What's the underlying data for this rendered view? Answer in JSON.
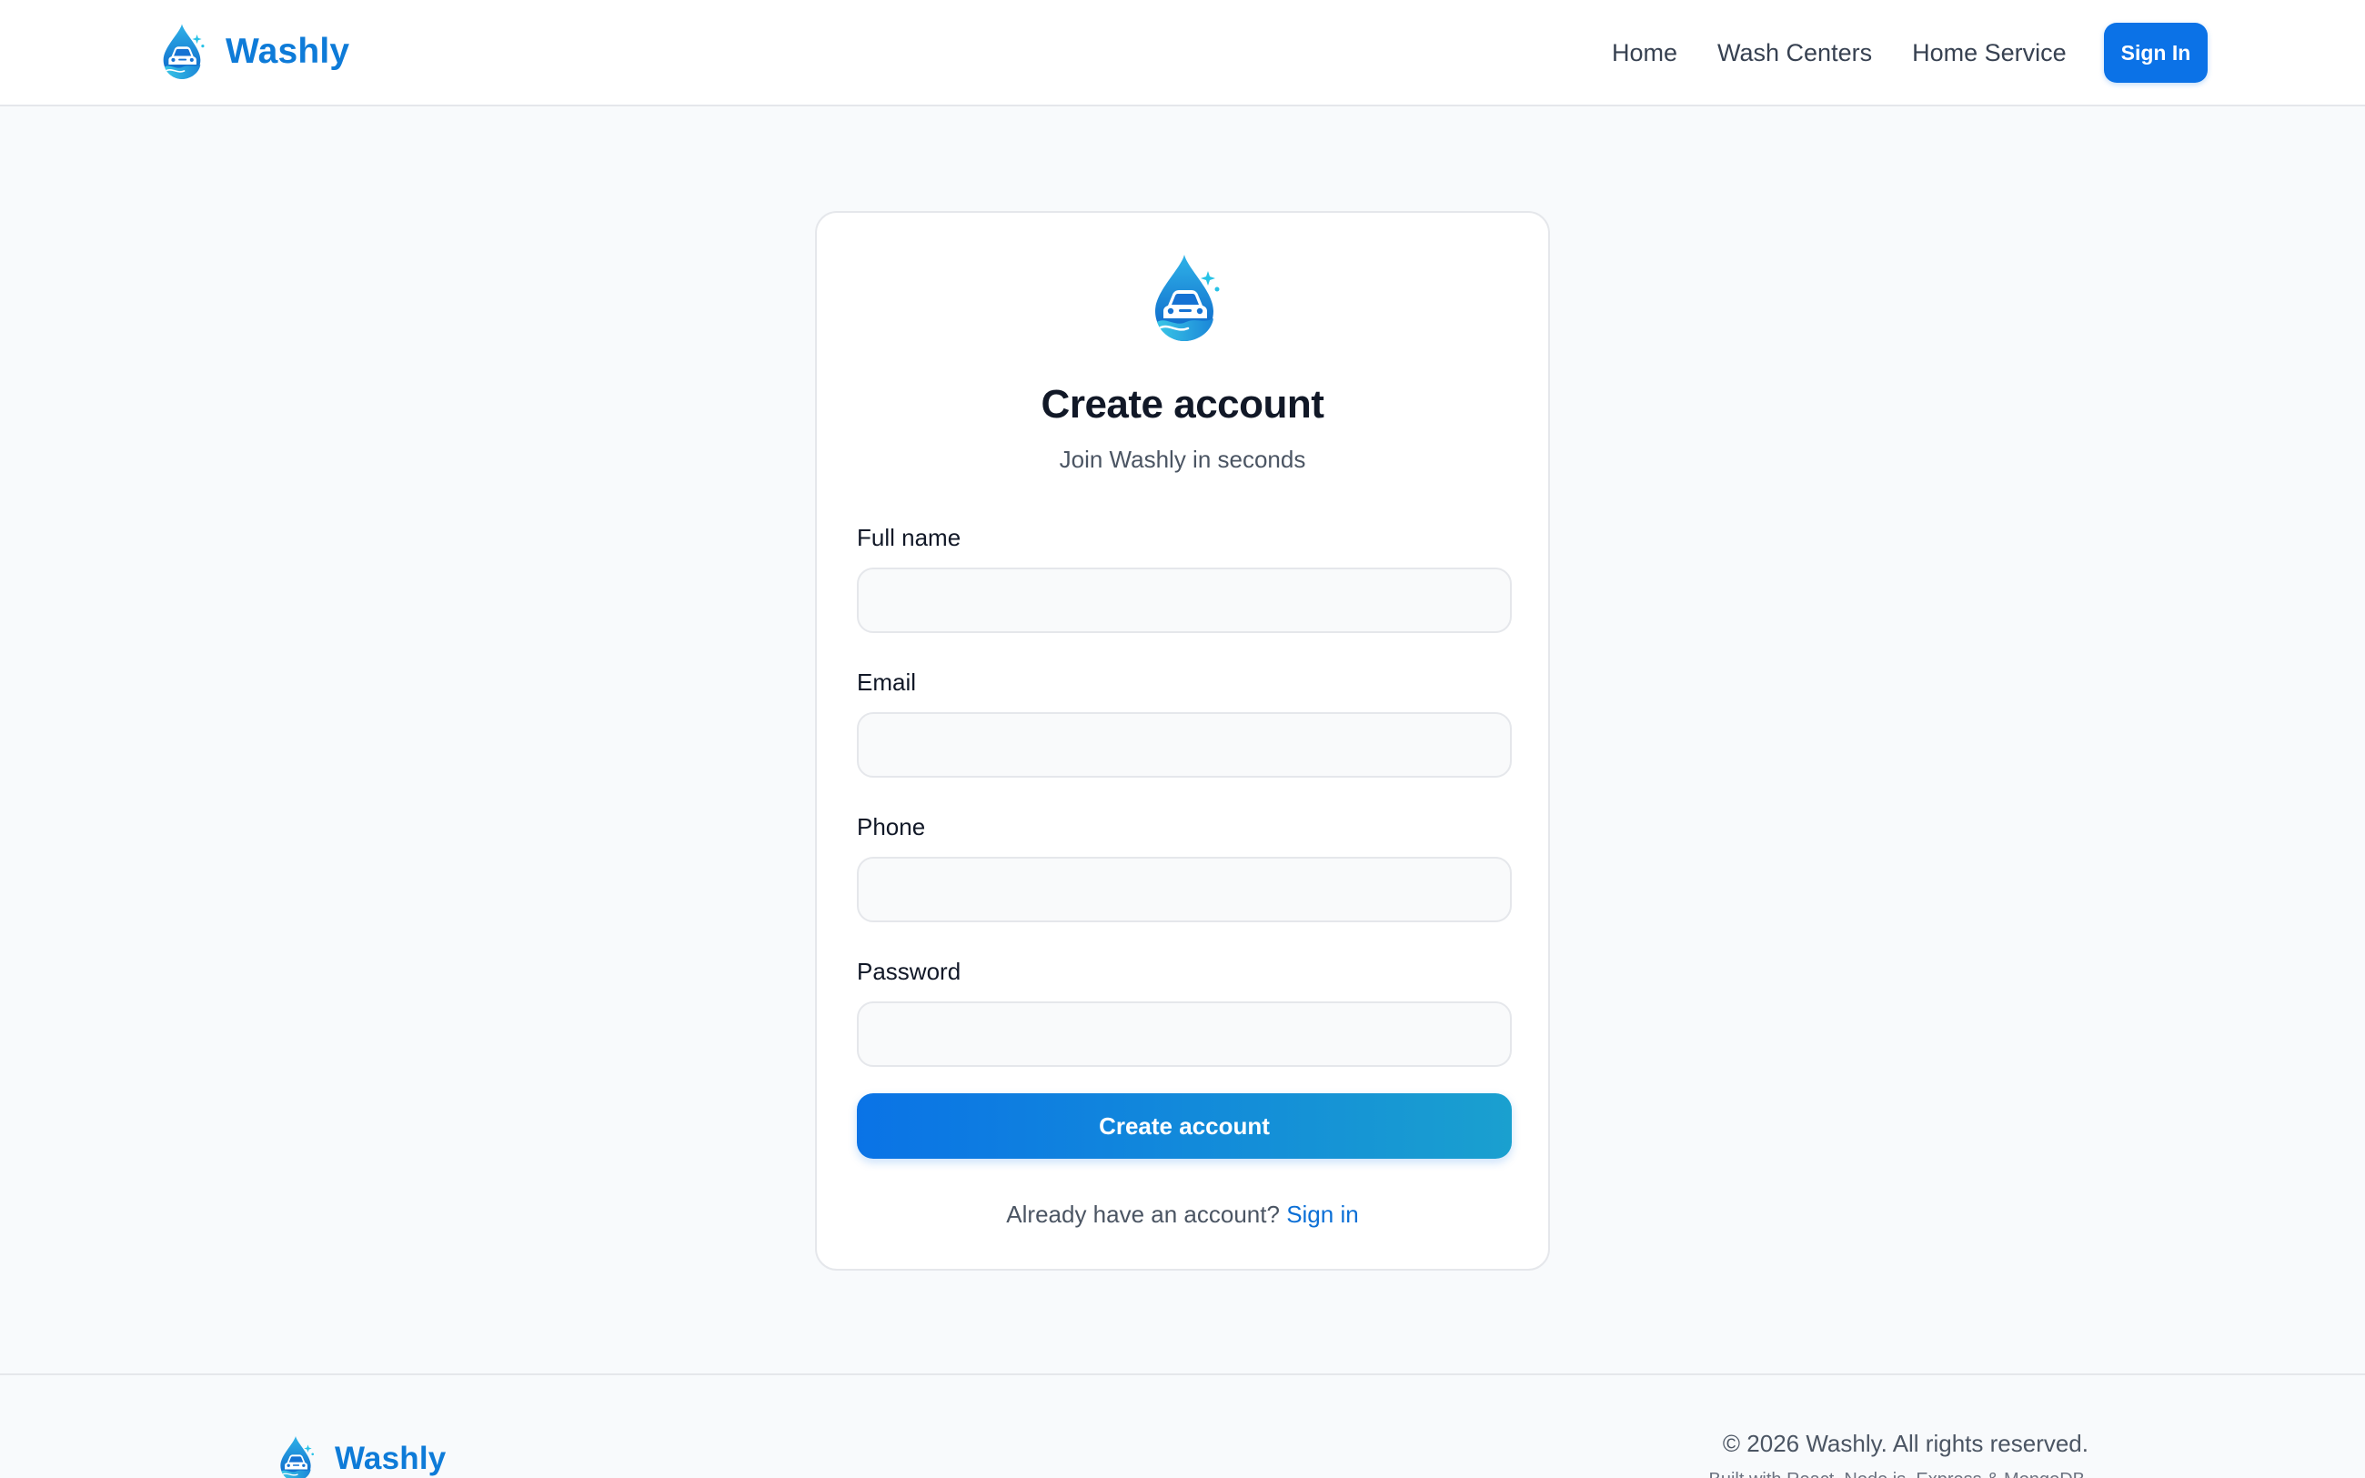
{
  "brand": {
    "name": "Washly",
    "icon": "water-drop-car-icon",
    "color": "#0e7bd8"
  },
  "nav": {
    "links": [
      "Home",
      "Wash Centers",
      "Home Service"
    ],
    "signin_label": "Sign In"
  },
  "card": {
    "title": "Create account",
    "subtitle": "Join Washly in seconds",
    "fields": {
      "full_name": {
        "label": "Full name",
        "value": "",
        "placeholder": ""
      },
      "email": {
        "label": "Email",
        "value": "",
        "placeholder": ""
      },
      "phone": {
        "label": "Phone",
        "value": "",
        "placeholder": ""
      },
      "password": {
        "label": "Password",
        "value": "",
        "placeholder": ""
      }
    },
    "submit_label": "Create account",
    "alt_prompt": "Already have an account?",
    "alt_link": "Sign in"
  },
  "footer": {
    "brand_name": "Washly",
    "copyright": "© 2026 Washly. All rights reserved.",
    "built_with": "Built with React, Node.js, Express & MongoDB"
  },
  "colors": {
    "primary": "#0b72e7",
    "gradient_end": "#1aa0cf",
    "background": "#f8fafc"
  }
}
